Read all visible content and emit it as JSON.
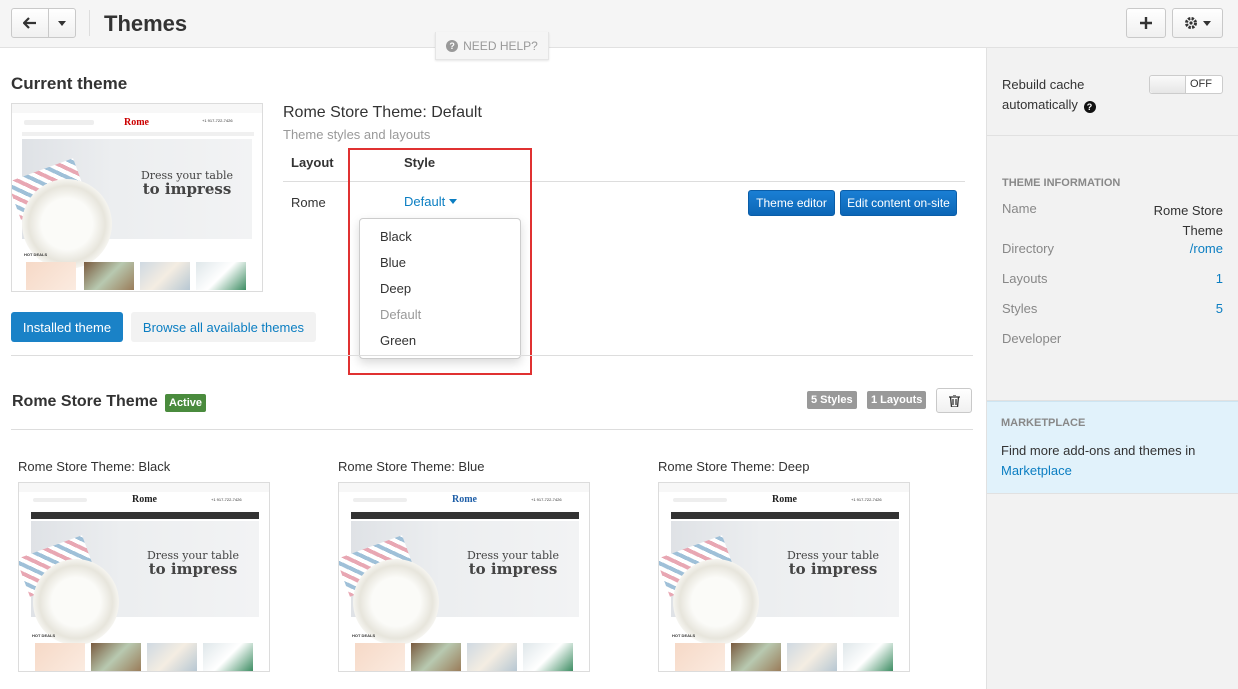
{
  "header": {
    "title": "Themes",
    "need_help": "NEED HELP?"
  },
  "current": {
    "heading": "Current theme",
    "theme_title": "Rome Store Theme: Default",
    "theme_subtitle": "Theme styles and layouts",
    "col_layout": "Layout",
    "col_style": "Style",
    "layout_value": "Rome",
    "style_value": "Default",
    "theme_editor_label": "Theme editor",
    "edit_content_label": "Edit content on-site"
  },
  "style_options": [
    "Black",
    "Blue",
    "Deep",
    "Default",
    "Green"
  ],
  "tabs": {
    "installed": "Installed theme",
    "browse": "Browse all available themes"
  },
  "theme_block": {
    "name": "Rome Store Theme",
    "active_badge": "Active",
    "styles_badge": "5 Styles",
    "layouts_badge": "1 Layouts"
  },
  "previews": [
    {
      "title": "Rome Store Theme: Black",
      "nav_color": "#333333",
      "logo_color": "#222222"
    },
    {
      "title": "Rome Store Theme: Blue",
      "nav_color": "#333333",
      "logo_color": "#1f5fa8"
    },
    {
      "title": "Rome Store Theme: Deep",
      "nav_color": "#333333",
      "logo_color": "#222222"
    }
  ],
  "thumb_text": {
    "logo": "Rome",
    "hero_line1": "Dress your table",
    "hero_line2": "to impress",
    "hot_deals": "HOT DEALS",
    "phone": "+1 917-722-7426"
  },
  "sidebar": {
    "rebuild_label": "Rebuild cache automatically",
    "toggle_state": "OFF",
    "info_title": "THEME INFORMATION",
    "name_label": "Name",
    "name_value": "Rome Store Theme",
    "directory_label": "Directory",
    "directory_value": "/rome",
    "layouts_label": "Layouts",
    "layouts_value": "1",
    "styles_label": "Styles",
    "styles_value": "5",
    "developer_label": "Developer",
    "marketplace_title": "MARKETPLACE",
    "marketplace_text": "Find more add-ons and themes in",
    "marketplace_link": "Marketplace"
  },
  "colors": {
    "accent": "#0b7ec2",
    "primary_button": "#1373c9",
    "active_badge": "#4a8b3d",
    "highlight": "#e03131",
    "marketplace_bg": "#e1f2fb"
  }
}
